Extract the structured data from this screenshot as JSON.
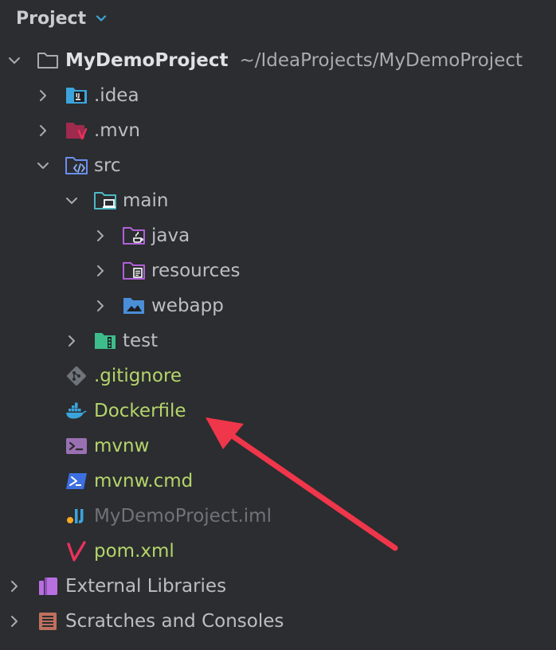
{
  "header": {
    "title": "Project"
  },
  "project": {
    "name": "MyDemoProject",
    "path": "~/IdeaProjects/MyDemoProject"
  },
  "tree": {
    "idea": ".idea",
    "mvn": ".mvn",
    "src": "src",
    "main": "main",
    "java": "java",
    "resources": "resources",
    "webapp": "webapp",
    "test": "test",
    "gitignore": ".gitignore",
    "dockerfile": "Dockerfile",
    "mvnw": "mvnw",
    "mvnw_cmd": "mvnw.cmd",
    "iml": "MyDemoProject.iml",
    "pom": "pom.xml"
  },
  "external_libraries": "External Libraries",
  "scratches": "Scratches and Consoles",
  "colors": {
    "background": "#2b2d30",
    "vcs_new_file": "#b5d56a",
    "ignored_file": "#6f737a",
    "annotation_arrow": "#f0364a"
  }
}
